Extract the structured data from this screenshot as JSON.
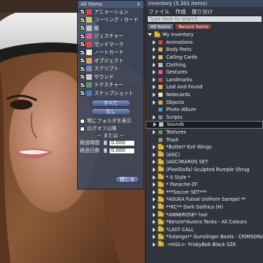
{
  "filter_panel": {
    "title": "All Items",
    "items": [
      {
        "label": "アニメーション",
        "checked": true,
        "icon": "animation-icon",
        "color": "#c84a4a"
      },
      {
        "label": "コーリング・カード",
        "checked": true,
        "icon": "calling-card-icon",
        "color": "#d8c068"
      },
      {
        "label": "服",
        "checked": true,
        "icon": "clothing-icon",
        "color": "#c0c0c8"
      },
      {
        "label": "ジェスチャー",
        "checked": true,
        "icon": "gesture-icon",
        "color": "#e05a9a"
      },
      {
        "label": "ランドマーク",
        "checked": true,
        "icon": "landmark-icon",
        "color": "#d84a4a"
      },
      {
        "label": "ノートカード",
        "checked": true,
        "icon": "notecard-icon",
        "color": "#f0e8c8"
      },
      {
        "label": "オブジェクト",
        "checked": true,
        "icon": "object-icon",
        "color": "#e0a060"
      },
      {
        "label": "スクリプト",
        "checked": true,
        "icon": "script-icon",
        "color": "#6a8ac8"
      },
      {
        "label": "サウンド",
        "checked": true,
        "icon": "sound-icon",
        "color": "#c8c8c8"
      },
      {
        "label": "テクスチャー",
        "checked": true,
        "icon": "texture-icon",
        "color": "#5a9a5a"
      },
      {
        "label": "スナップショット",
        "checked": true,
        "icon": "snapshot-icon",
        "color": "#4a7ac0"
      }
    ],
    "all_button": "すべて",
    "none_button": "なし",
    "always_show_folders": "常にフォルダを表示",
    "since_logoff": "ログオフ以降",
    "or_label": "－ または －",
    "hours_ago_label": "経過時間",
    "hours_ago_value": "0.000",
    "days_ago_label": "経過日数",
    "days_ago_value": "0.000",
    "close_button": "閉じる"
  },
  "inventory": {
    "title": "Inventory (5,301 items)",
    "menu": [
      "ファイル",
      "作成",
      "振り分け"
    ],
    "search_placeholder": "Type here to search",
    "tabs": [
      "All Items",
      "Recent Items"
    ],
    "root": "My Inventory",
    "system_folders": [
      {
        "label": "Animations",
        "icon": "animations-folder-icon",
        "color": "#c84a4a"
      },
      {
        "label": "Body Parts",
        "icon": "body-parts-folder-icon",
        "color": "#d8a878"
      },
      {
        "label": "Calling Cards",
        "icon": "calling-cards-folder-icon",
        "color": "#d8c068"
      },
      {
        "label": "Clothing",
        "icon": "clothing-folder-icon",
        "color": "#c0c0c8"
      },
      {
        "label": "Gestures",
        "icon": "gestures-folder-icon",
        "color": "#e05a9a"
      },
      {
        "label": "Landmarks",
        "icon": "landmarks-folder-icon",
        "color": "#d84a4a"
      },
      {
        "label": "Lost And Found",
        "icon": "lost-and-found-folder-icon",
        "color": "#d8b64a"
      },
      {
        "label": "Notecards",
        "icon": "notecards-folder-icon",
        "color": "#f0e8c8"
      },
      {
        "label": "Objects",
        "icon": "objects-folder-icon",
        "color": "#e0a060"
      },
      {
        "label": "Photo Album",
        "icon": "photo-album-icon",
        "color": "#5a8ad0"
      },
      {
        "label": "Scripts",
        "icon": "scripts-folder-icon",
        "color": "#6a8ac8"
      },
      {
        "label": "Sounds",
        "icon": "sounds-folder-icon",
        "color": "#c8c8c8",
        "selected": true
      },
      {
        "label": "Textures",
        "icon": "textures-folder-icon",
        "color": "#5a9a5a"
      },
      {
        "label": "Trash",
        "icon": "trash-icon",
        "color": "#909090"
      }
    ],
    "user_folders": [
      "*Butter* Evil Wings",
      "(AGC)",
      "(AGC)IKAROS SET",
      "(PixelDolls) Sculpted Rumple Shrug",
      "* 0 Style *",
      "* Panache-ZF",
      "***Soccer SET***",
      "*ASUKA Futsal  Unifrom Sampel **",
      "**KC** Dark Gothica (H)",
      "*ANNEROSE* hair",
      "*Kenzie*Aurora Tanks - All Colours",
      "*LAST CALL",
      "*Solange!* Gunslinger Boots - CRIMSON/gold",
      "-=H2L=- FriskyBob Black SZK"
    ]
  }
}
